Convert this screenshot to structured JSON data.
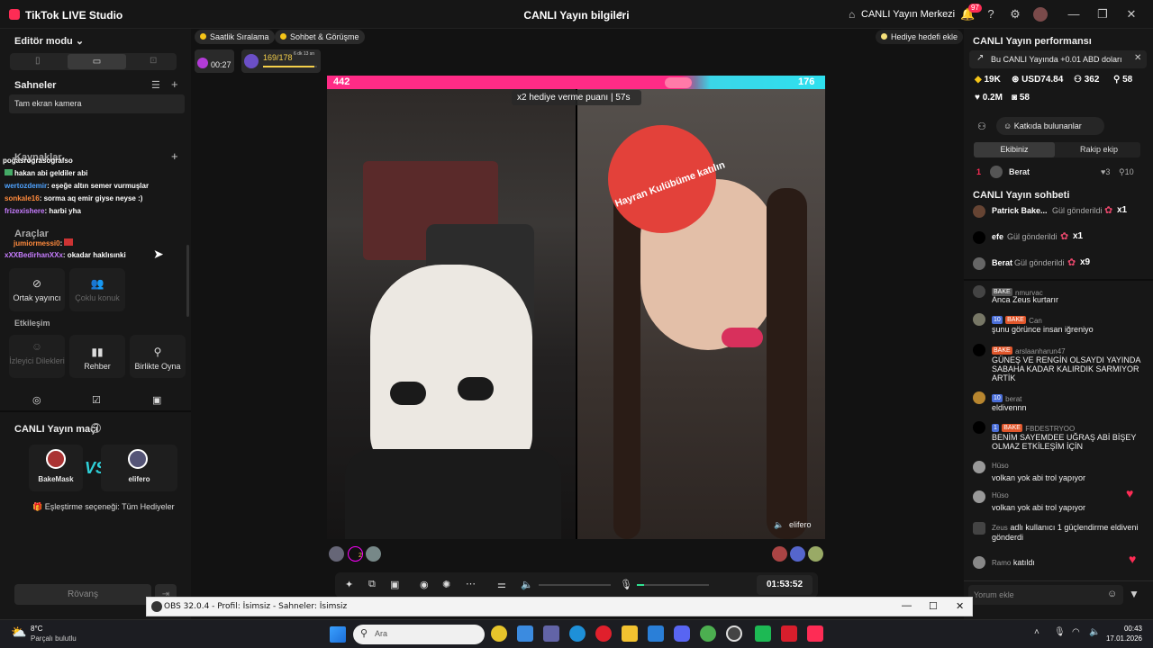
{
  "titlebar": {
    "app_title": "TikTok LIVE Studio",
    "center_title": "CANLI Yayın bilgileri",
    "live_center": "CANLI Yayın Merkezi",
    "notif_count": "97",
    "minimize": "—",
    "maximize": "❐",
    "close": "✕"
  },
  "left": {
    "editor_mode": "Editör modu",
    "scenes_title": "Sahneler",
    "scene_item": "Tam ekran kamera",
    "sources_title": "Kaynaklar",
    "tools_title": "Araçlar",
    "tools": [
      {
        "label": "Ortak yayıncı",
        "enabled": true
      },
      {
        "label": "Çoklu konuk",
        "enabled": false
      }
    ],
    "interaction_title": "Etkileşim",
    "interaction": [
      {
        "label": "İzleyici Dilekleri",
        "enabled": false
      },
      {
        "label": "Rehber",
        "enabled": true
      },
      {
        "label": "Birlikte Oyna",
        "enabled": true
      }
    ],
    "match_title": "CANLI Yayın maçı",
    "player1": "BakeMask",
    "player2": "elifero",
    "match_option": "Eşleştirme seçeneği: Tüm Hediyeler",
    "rematch": "Rövanş"
  },
  "overlay_chat": [
    {
      "user": "poğasrograsografso",
      "text": "",
      "color": "#ffffff"
    },
    {
      "user": "hakan abi geldiler abi",
      "text": "",
      "color": "#ffffff"
    },
    {
      "user": "wertozdemir",
      "text": ": eşeğe altın semer vurmuşlar",
      "color": "#4fa3ff"
    },
    {
      "user": "sonkale16",
      "text": ": sorma aq emir giyse neyse :)",
      "color": "#ff8a3d"
    },
    {
      "user": "frizexishere",
      "text": ": harbi yha",
      "color": "#c77dff"
    },
    {
      "user": "jumiormessi0",
      "text": ":",
      "color": "#ff8a3d"
    },
    {
      "user": "xXXBedirhanXXx",
      "text": ": okadar haklısınki",
      "color": "#c77dff"
    }
  ],
  "stage": {
    "chip1": "Saatlik Sıralama",
    "chip2": "Sohbet & Görüşme",
    "gift_goal": "Hediye hedefi ekle",
    "timer": "00:27",
    "progress": "169/178",
    "progress_fraction": 0.95,
    "progress_sub": "6 dk 13 sn",
    "score_left": "442",
    "score_right": "176",
    "multiplier": "x2 hediye verme puanı",
    "multiplier_time": "57s",
    "fan_club": "Hayran Kulübüme katılın",
    "guest_name": "elifero",
    "elapsed": "01:53:52",
    "badge_count": "2"
  },
  "right": {
    "perf_title": "CANLI Yayın performansı",
    "promo": "Bu CANLI Yayında +0.01 ABD doları",
    "stats": [
      "19K",
      "USD74.84",
      "362",
      "58",
      "0.2M",
      "58"
    ],
    "contributors_btn": "Katkıda bulunanlar",
    "tab_team": "Ekibiniz",
    "tab_rival": "Rakip ekip",
    "top_rank": "1",
    "top_user": "Berat",
    "top_hearts": "3",
    "top_count": "10",
    "chat_title": "CANLI Yayın sohbeti",
    "gifts": [
      {
        "user": "Patrick Bake...",
        "text": "Gül gönderildi",
        "count": "x1"
      },
      {
        "user": "efe",
        "text": "Gül gönderildi",
        "count": "x1"
      },
      {
        "user": "Berat",
        "text": "Gül gönderildi",
        "count": "x9"
      }
    ],
    "messages": [
      {
        "name": "nmurvac",
        "badges": [
          "BAKE"
        ],
        "text": "Anca Zeus kurtarır"
      },
      {
        "name": "Can",
        "badges": [
          "10",
          "BAKE"
        ],
        "text": "şunu görünce insan iğreniyo"
      },
      {
        "name": "arslaanharun47",
        "badges": [
          "BAKE"
        ],
        "text": "GÜNEŞ VE RENGİN OLSAYDI YAYINDA SABAHA KADAR KALIRDIK SARMIYOR ARTİK"
      },
      {
        "name": "berat",
        "badges": [
          "10"
        ],
        "text": "eldivennn"
      },
      {
        "name": "FBDESTRYOO",
        "badges": [
          "1",
          "BAKE"
        ],
        "text": "BENİM SAYEMDEE UĞRAŞ ABİ BİŞEY OLMAZ ETKİLEŞİM İÇİN"
      },
      {
        "name": "Hüso",
        "badges": [],
        "text": "volkan yok abi trol yapıyor"
      },
      {
        "name": "Hüso",
        "badges": [],
        "text": "volkan yok abi trol yapıyor"
      },
      {
        "name": "Zeus",
        "badges": [],
        "text": "adlı kullanıcı 1 güçlendirme eldiveni gönderdi"
      },
      {
        "name": "Ramo",
        "badges": [],
        "text": "katıldı"
      }
    ],
    "comment_placeholder": "Yorum ekle"
  },
  "obs": {
    "title": "OBS 32.0.4 - Profil: İsimsiz - Sahneler: İsimsiz"
  },
  "taskbar": {
    "temp": "8°C",
    "weather": "Parçalı bulutlu",
    "search": "Ara",
    "time": "00:43",
    "date": "17.01.2026"
  }
}
